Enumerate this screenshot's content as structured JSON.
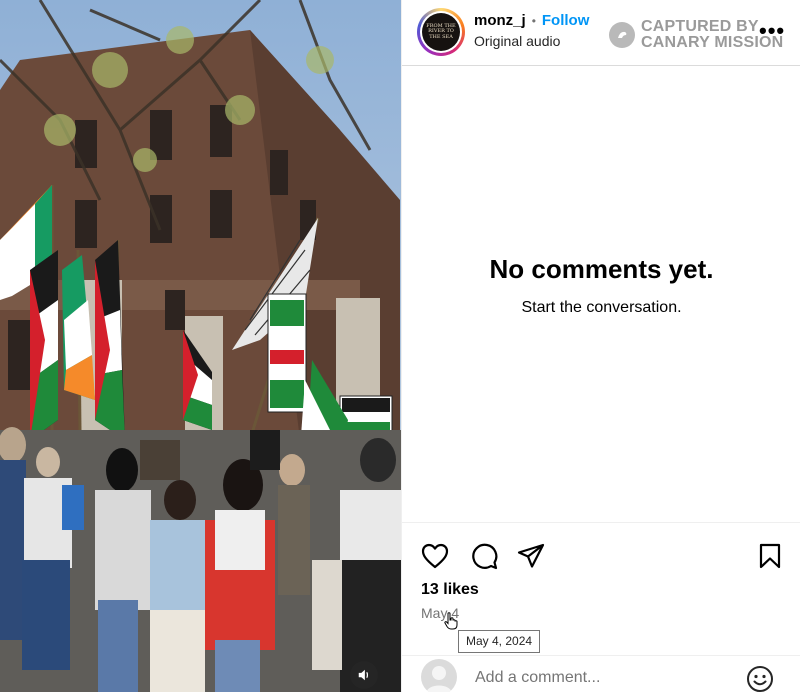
{
  "post": {
    "username": "monz_j",
    "separator": "•",
    "follow_label": "Follow",
    "audio_label": "Original audio",
    "avatar_text": [
      "FROM THE",
      "RIVER TO",
      "THE SEA"
    ],
    "more_label": "•••"
  },
  "watermark": {
    "line1": "CAPTURED BY",
    "line2": "CANARY MISSION"
  },
  "comments": {
    "empty_title": "No comments yet.",
    "empty_subtitle": "Start the conversation."
  },
  "actions": {
    "icons": [
      "heart-icon",
      "comment-icon",
      "share-icon",
      "bookmark-icon"
    ],
    "likes": "13 likes",
    "date": "May 4",
    "date_tooltip": "May 4, 2024"
  },
  "composer": {
    "placeholder": "Add a comment..."
  },
  "media": {
    "audio_icon": "speaker-icon"
  },
  "colors": {
    "accent": "#0095f6",
    "border": "#dbdbdb",
    "muted": "#737373"
  }
}
